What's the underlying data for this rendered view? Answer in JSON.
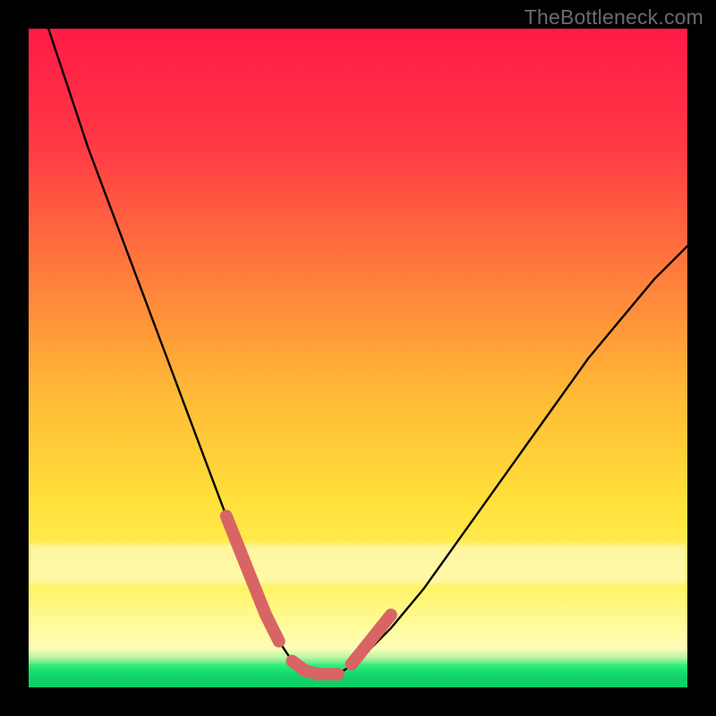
{
  "watermark": "TheBottleneck.com",
  "colors": {
    "frame": "#000000",
    "grad_top": "#ff1a47",
    "grad_mid_upper": "#ff6a3a",
    "grad_mid": "#ffd233",
    "grad_lower": "#fff566",
    "grad_glow": "#fffde0",
    "green_top": "#37f17b",
    "green_bottom": "#0ecf66",
    "curve": "#000000",
    "marker": "#d96464"
  },
  "chart_data": {
    "type": "line",
    "title": "",
    "xlabel": "",
    "ylabel": "",
    "xlim": [
      0,
      100
    ],
    "ylim": [
      0,
      100
    ],
    "series": [
      {
        "name": "bottleneck-curve",
        "x": [
          3,
          6,
          9,
          12,
          15,
          18,
          21,
          24,
          27,
          30,
          32,
          34,
          36,
          38,
          40,
          42,
          44,
          47,
          50,
          55,
          60,
          65,
          70,
          75,
          80,
          85,
          90,
          95,
          100
        ],
        "y": [
          100,
          91,
          82,
          74,
          66,
          58,
          50,
          42,
          34,
          26,
          21,
          16,
          11,
          7,
          4,
          2.5,
          2,
          2,
          4,
          9,
          15,
          22,
          29,
          36,
          43,
          50,
          56,
          62,
          67
        ]
      }
    ],
    "markers": {
      "name": "highlight-segments",
      "segments": [
        {
          "x": [
            30,
            32,
            34,
            36,
            38
          ],
          "y": [
            26,
            21,
            16,
            11,
            7
          ]
        },
        {
          "x": [
            40,
            42,
            44,
            47
          ],
          "y": [
            4,
            2.5,
            2,
            2
          ]
        },
        {
          "x": [
            49,
            51,
            53,
            55
          ],
          "y": [
            3.5,
            6,
            8.5,
            11
          ]
        }
      ]
    },
    "bands": [
      {
        "name": "glow",
        "y_from": 18,
        "y_to": 25
      },
      {
        "name": "green",
        "y_from": 0,
        "y_to": 3.5
      }
    ]
  }
}
